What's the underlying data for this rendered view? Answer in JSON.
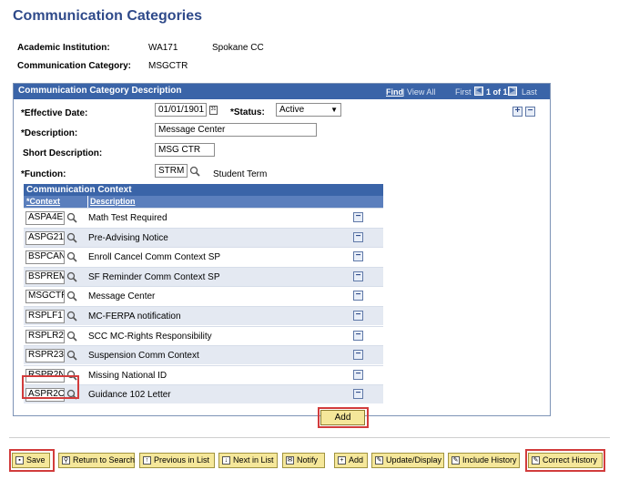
{
  "page_title": "Communication Categories",
  "header": {
    "institution_label": "Academic Institution:",
    "institution_code": "WA171",
    "institution_name": "Spokane CC",
    "category_label": "Communication Category:",
    "category_value": "MSGCTR"
  },
  "panel": {
    "title": "Communication Category Description",
    "nav": {
      "find": "Find",
      "view_all": "View All",
      "first": "First",
      "counter": "1 of 1",
      "last": "Last"
    },
    "fields": {
      "effective_date_label": "*Effective Date:",
      "effective_date": "01/01/1901",
      "status_label": "*Status:",
      "status": "Active",
      "description_label": "*Description:",
      "description": "Message Center",
      "short_description_label": "Short Description:",
      "short_description": "MSG CTR",
      "function_label": "*Function:",
      "function": "STRM",
      "function_desc": "Student Term"
    }
  },
  "context_grid": {
    "title": "Communication Context",
    "col_context": "*Context",
    "col_description": "Description",
    "rows": [
      {
        "context": "ASPA4E",
        "description": "Math Test Required"
      },
      {
        "context": "ASPG21",
        "description": "Pre-Advising Notice"
      },
      {
        "context": "BSPCAN",
        "description": "Enroll Cancel Comm Context SP"
      },
      {
        "context": "BSPREM",
        "description": "SF Reminder Comm Context SP"
      },
      {
        "context": "MSGCTR",
        "description": "Message Center"
      },
      {
        "context": "RSPLF1",
        "description": "MC-FERPA notification"
      },
      {
        "context": "RSPLR2",
        "description": "SCC MC-Rights Responsibility"
      },
      {
        "context": "RSPR23",
        "description": "Suspension Comm Context"
      },
      {
        "context": "RSPR2N",
        "description": "Missing National ID"
      },
      {
        "context": "ASPR2O",
        "description": "Guidance 102 Letter"
      }
    ],
    "add_label": "Add"
  },
  "toolbar": {
    "save": "Save",
    "return_to_search": "Return to Search",
    "previous_in_list": "Previous in List",
    "next_in_list": "Next in List",
    "notify": "Notify",
    "add": "Add",
    "update_display": "Update/Display",
    "include_history": "Include History",
    "correct_history": "Correct History"
  },
  "colors": {
    "accent": "#3a64a8",
    "highlight": "#d23c3c",
    "button": "#f5e79a"
  }
}
